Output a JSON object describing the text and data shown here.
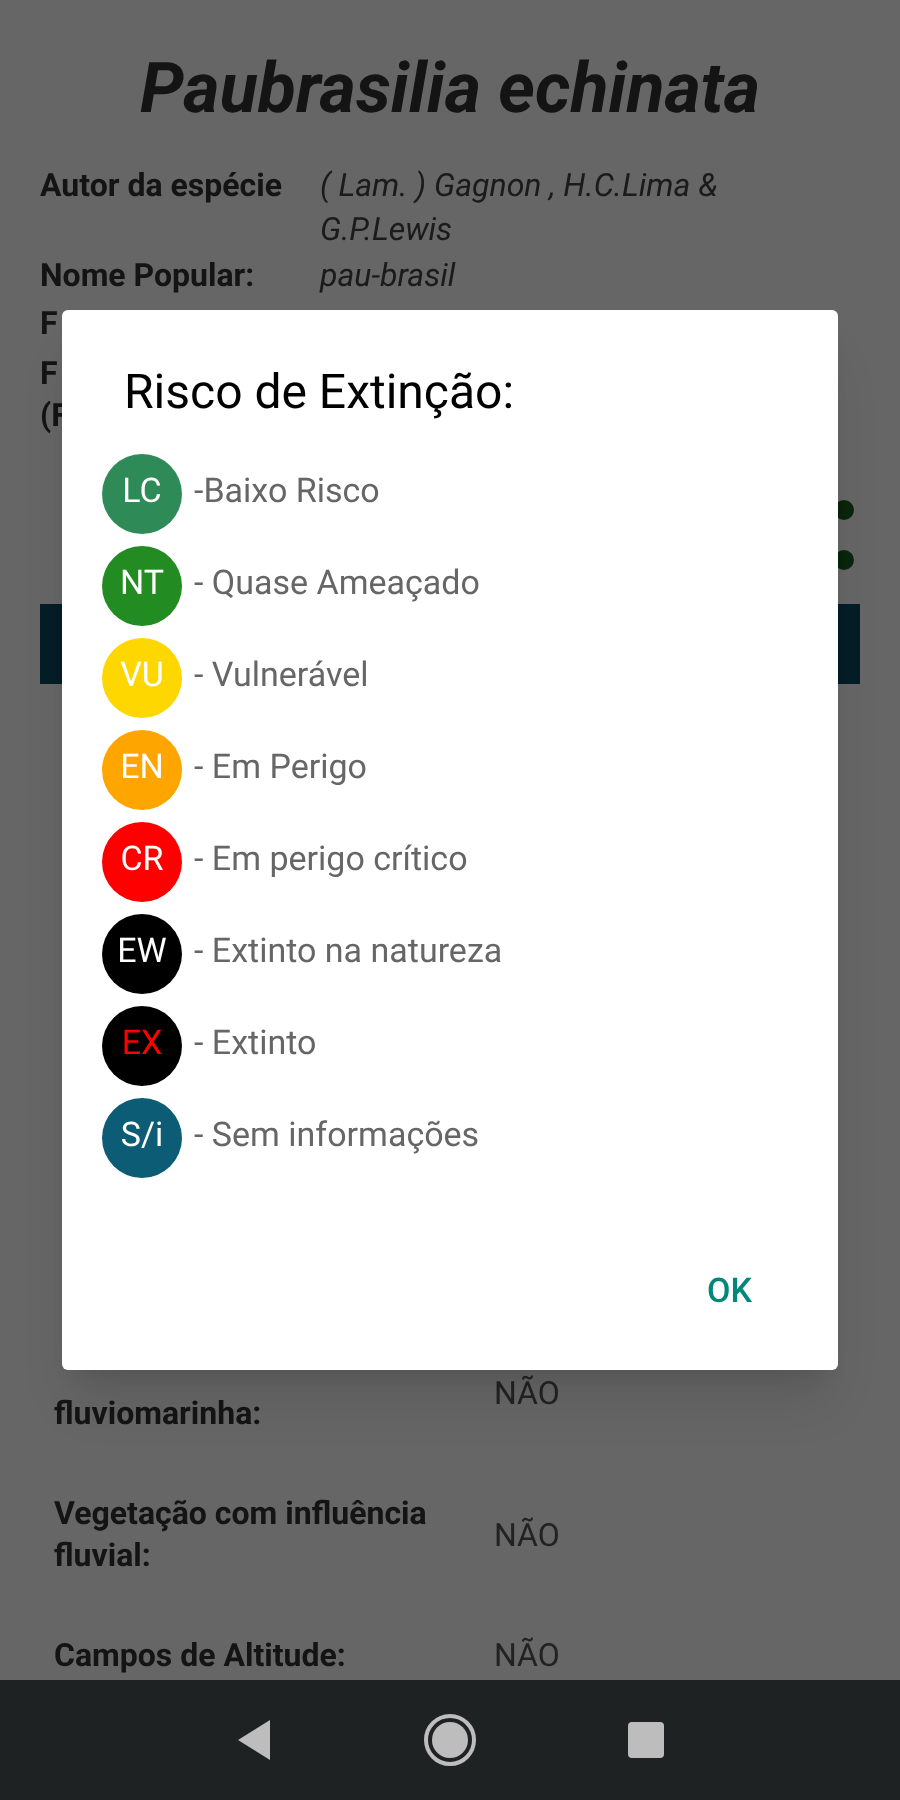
{
  "page": {
    "title": "Paubrasilia echinata",
    "top_rows": [
      {
        "label": "Autor da espécie",
        "value": "( Lam. ) Gagnon , H.C.Lima & G.P.Lewis"
      },
      {
        "label": "Nome Popular:",
        "value": "pau-brasil"
      }
    ],
    "cut_labels_top": [
      [
        "F"
      ],
      [
        "F",
        "(F"
      ]
    ],
    "bottom_rows": [
      {
        "label": "fluviomarinha:",
        "value": "NÃO"
      },
      {
        "label": "Vegetação com influência fluvial:",
        "value": "NÃO"
      },
      {
        "label": "Campos de Altitude:",
        "value": "NÃO"
      }
    ]
  },
  "dialog": {
    "title": "Risco de Extinção:",
    "items": [
      {
        "code": "LC",
        "label": "-Baixo Risco",
        "color": "#2e8b57",
        "kind": "plain"
      },
      {
        "code": "NT",
        "label": "- Quase Ameaçado",
        "color": "#228b22",
        "kind": "plain"
      },
      {
        "code": "VU",
        "label": "- Vulnerável",
        "color": "#ffd700",
        "kind": "plain"
      },
      {
        "code": "EN",
        "label": "- Em Perigo",
        "color": "#ffa500",
        "kind": "plain"
      },
      {
        "code": "CR",
        "label": "- Em perigo crítico",
        "color": "#ff0000",
        "kind": "plain"
      },
      {
        "code": "EW",
        "label": "- Extinto na natureza",
        "color": "#000000",
        "kind": "plain"
      },
      {
        "code": "EX",
        "label": "- Extinto",
        "color": "#000000",
        "kind": "alert"
      },
      {
        "code": "S/i",
        "label": "- Sem informações",
        "color": "#0d5c75",
        "kind": "plain"
      }
    ],
    "button": "OK"
  }
}
